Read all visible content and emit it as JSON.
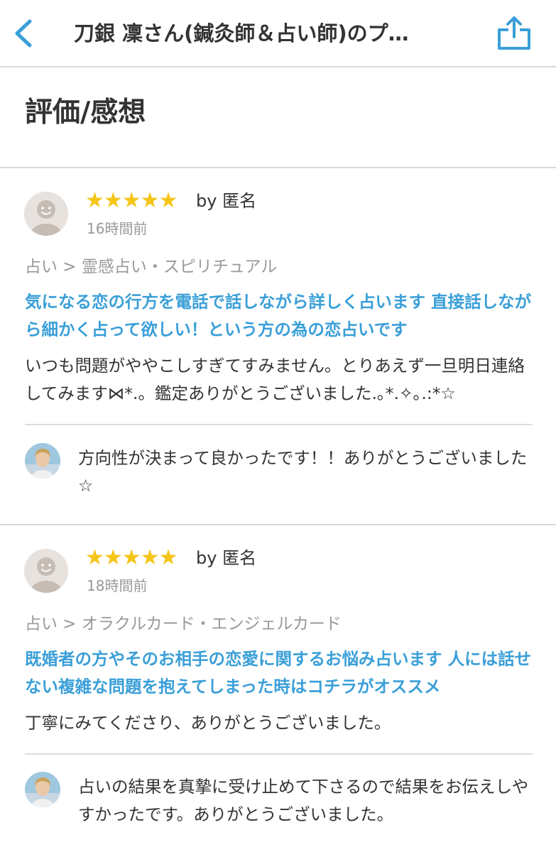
{
  "nav": {
    "title": "刀銀 凜さん(鍼灸師＆占い師)のプ…"
  },
  "section": {
    "title": "評価/感想"
  },
  "reviews": [
    {
      "stars": "★★★★★",
      "by": "by 匿名",
      "time": "16時間前",
      "category": "占い > 霊感占い・スピリチュアル",
      "service_title": "気になる恋の行方を電話で話しながら詳しく占います 直接話しながら細かく占って欲しい！という方の為の恋占いです",
      "body": "いつも問題がややこしすぎてすみません。とりあえず一旦明日連絡してみます⋈*.。鑑定ありがとうございました.｡*.✧｡.:*☆",
      "reply": "方向性が決まって良かったです！！ありがとうございました☆"
    },
    {
      "stars": "★★★★★",
      "by": "by 匿名",
      "time": "18時間前",
      "category": "占い > オラクルカード・エンジェルカード",
      "service_title": "既婚者の方やそのお相手の恋愛に関するお悩み占います 人には話せない複雑な問題を抱えてしまった時はコチラがオススメ",
      "body": "丁寧にみてくださり、ありがとうございました。",
      "reply": "占いの結果を真摯に受け止めて下さるので結果をお伝えしやすかったです。ありがとうございました。"
    }
  ],
  "colors": {
    "accent": "#3a9fd8",
    "star": "#f5c518",
    "muted": "#999999",
    "text": "#333333"
  },
  "icons": {
    "back": "chevron-left-icon",
    "share": "share-icon",
    "avatar": "default-avatar-icon"
  }
}
